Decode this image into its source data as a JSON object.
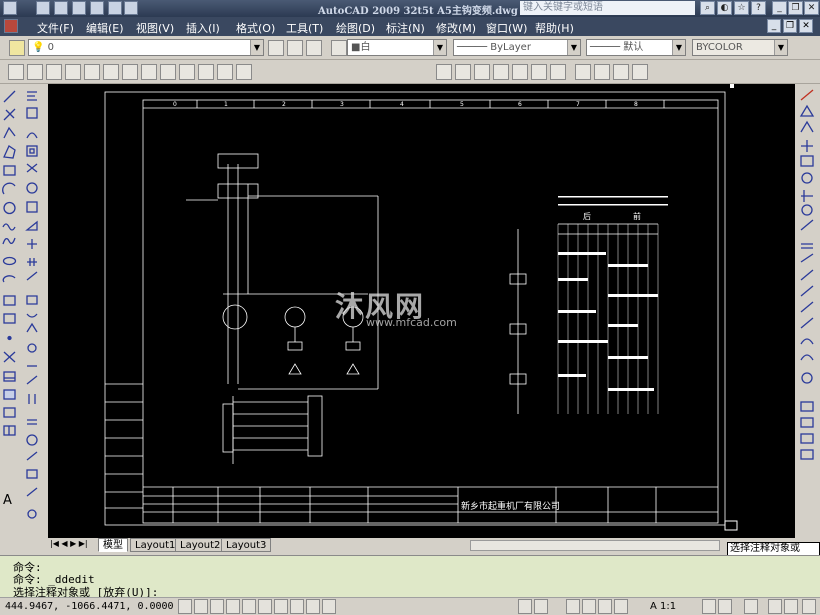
{
  "window": {
    "title": "AutoCAD 2009  32t5t A5主钩变频.dwg",
    "search_placeholder": "键入关键字或短语"
  },
  "menu": [
    "文件(F)",
    "编辑(E)",
    "视图(V)",
    "插入(I)",
    "格式(O)",
    "工具(T)",
    "绘图(D)",
    "标注(N)",
    "修改(M)",
    "窗口(W)",
    "帮助(H)"
  ],
  "layer": {
    "current": "0",
    "color": "■白",
    "linetype": "ByLayer",
    "lineweight": "默认",
    "plotstyle": "BYCOLOR"
  },
  "drawing": {
    "company": "新乡市起重机厂有限公司",
    "grid_numbers": [
      "0",
      "1",
      "2",
      "3",
      "4",
      "5",
      "6",
      "7",
      "8"
    ],
    "watermark": "沐风网",
    "watermark_url": "www.mfcad.com",
    "marks": [
      "前",
      "后"
    ]
  },
  "layout_tabs": [
    "模型",
    "Layout1",
    "Layout2",
    "Layout3"
  ],
  "tooltip": "选择注释对象或",
  "command": {
    "lines": [
      "命令:",
      "命令:  _ddedit",
      "选择注释对象或 [放弃(U)]:"
    ]
  },
  "status": {
    "coords": "444.9467, -1066.4471, 0.0000",
    "scale": "A 1:1"
  },
  "colors": {
    "canvas": "#000000",
    "drawing": "#ffffff",
    "command_bg": "#dfe8c8",
    "titlebar": "#2c3a52"
  }
}
